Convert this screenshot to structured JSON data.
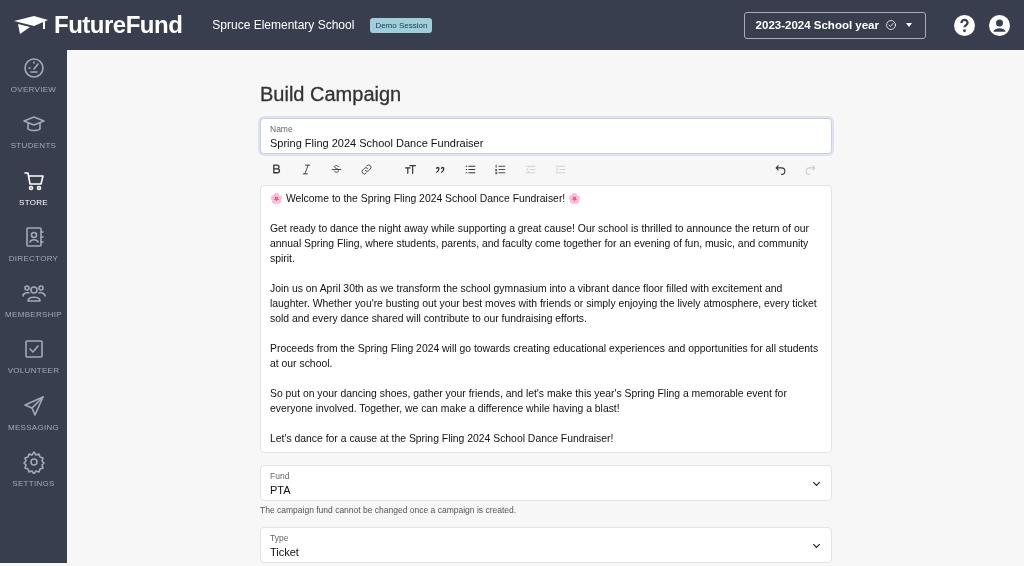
{
  "header": {
    "brand": "FutureFund",
    "school": "Spruce Elementary School",
    "badge": "Demo Session",
    "year_selector": "2023-2024 School year"
  },
  "sidebar": {
    "items": [
      {
        "label": "OVERVIEW",
        "selected": false
      },
      {
        "label": "STUDENTS",
        "selected": false
      },
      {
        "label": "STORE",
        "selected": true
      },
      {
        "label": "DIRECTORY",
        "selected": false
      },
      {
        "label": "MEMBERSHIP",
        "selected": false
      },
      {
        "label": "VOLUNTEER",
        "selected": false
      },
      {
        "label": "MESSAGING",
        "selected": false
      },
      {
        "label": "SETTINGS",
        "selected": false
      }
    ]
  },
  "page": {
    "title": "Build Campaign"
  },
  "name_field": {
    "label": "Name",
    "value": "Spring Fling 2024 School Dance Fundraiser"
  },
  "toolbar": [
    {
      "kind": "bold",
      "disabled": false
    },
    {
      "kind": "italic",
      "disabled": false
    },
    {
      "kind": "strike",
      "disabled": false
    },
    {
      "kind": "link",
      "disabled": false
    },
    {
      "kind": "heading",
      "disabled": false
    },
    {
      "kind": "quote",
      "disabled": false
    },
    {
      "kind": "bullets",
      "disabled": false
    },
    {
      "kind": "numbers",
      "disabled": false
    },
    {
      "kind": "outdent",
      "disabled": true
    },
    {
      "kind": "indent",
      "disabled": true
    },
    {
      "kind": "undo",
      "disabled": false
    },
    {
      "kind": "redo",
      "disabled": true
    }
  ],
  "editor": {
    "paragraphs": [
      "🌸 Welcome to the Spring Fling 2024 School Dance Fundraiser! 🌸",
      "Get ready to dance the night away while supporting a great cause! Our school is thrilled to announce the return of our annual Spring Fling, where students, parents, and faculty come together for an evening of fun, music, and community spirit.",
      "Join us on April 30th as we transform the school gymnasium into a vibrant dance floor filled with excitement and laughter. Whether you're busting out your best moves with friends or simply enjoying the lively atmosphere, every ticket sold and every dance shared will contribute to our fundraising efforts.",
      "Proceeds from the Spring Fling 2024 will go towards creating educational experiences and opportunities for all students at our school.",
      "So put on your dancing shoes, gather your friends, and let's make this year's Spring Fling a memorable event for everyone involved. Together, we can make a difference while having a blast!",
      "Let's dance for a cause at the Spring Fling 2024 School Dance Fundraiser!"
    ]
  },
  "fund_field": {
    "label": "Fund",
    "value": "PTA",
    "help": "The campaign fund cannot be changed once a campaign is created."
  },
  "type_field": {
    "label": "Type",
    "value": "Ticket"
  }
}
